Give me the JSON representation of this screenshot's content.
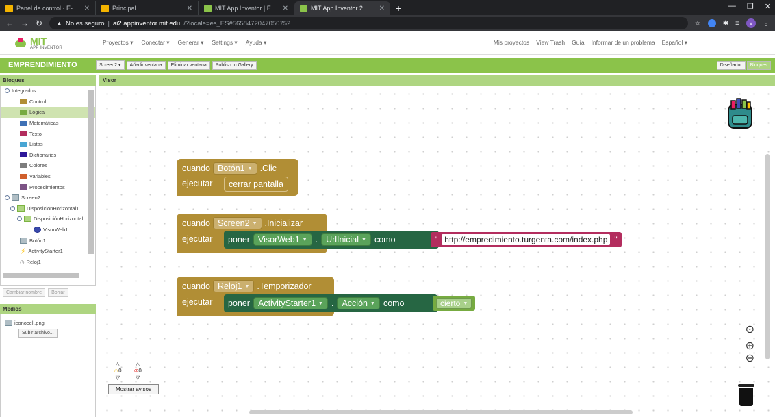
{
  "browser": {
    "tabs": [
      {
        "label": "Panel de control · E-mprendimie",
        "active": false
      },
      {
        "label": "Principal",
        "active": false
      },
      {
        "label": "MIT App Inventor | Explore MIT",
        "active": false
      },
      {
        "label": "MIT App Inventor 2",
        "active": true
      }
    ],
    "new_tab": "+",
    "security_label": "No es seguro",
    "url_host": "ai2.appinventor.mit.edu",
    "url_path": "/?locale=es_ES#5658472047050752"
  },
  "app": {
    "logo_text": "MIT",
    "logo_sub": "APP INVENTOR",
    "menu": [
      "Proyectos ▾",
      "Conectar ▾",
      "Generar ▾",
      "Settings ▾",
      "Ayuda ▾"
    ],
    "right_menu": [
      "Mis proyectos",
      "View Trash",
      "Guía",
      "Informar de un problema",
      "Español ▾"
    ],
    "project_title": "EMPRENDIMIENTO",
    "toolbar": [
      "Screen2 ▾",
      "Añadir ventana",
      "Eliminar ventana",
      "Publish to Gallery"
    ],
    "designer_label": "Diseñador",
    "blocks_label": "Bloques"
  },
  "blocks_panel": {
    "title": "Bloques",
    "root": "Integrados",
    "builtins": [
      {
        "label": "Control",
        "color": "#b18e35"
      },
      {
        "label": "Lógica",
        "color": "#77ab41"
      },
      {
        "label": "Matemáticas",
        "color": "#3f71b5"
      },
      {
        "label": "Texto",
        "color": "#b32d5e"
      },
      {
        "label": "Listas",
        "color": "#49a6d4"
      },
      {
        "label": "Dictionaries",
        "color": "#2d1799"
      },
      {
        "label": "Colores",
        "color": "#7d7d7d"
      },
      {
        "label": "Variables",
        "color": "#d05f2d"
      },
      {
        "label": "Procedimientos",
        "color": "#7c5385"
      }
    ],
    "components": {
      "screen": "Screen2",
      "h1": "DisposiciónHorizontal1",
      "h2": "DisposiciónHorizontal",
      "visor": "VisorWeb1",
      "boton": "Botón1",
      "activity": "ActivityStarter1",
      "reloj": "Reloj1"
    },
    "rename_btn": "Cambiar nombre",
    "delete_btn": "Borrar"
  },
  "media": {
    "title": "Medios",
    "file": "iconocell.png",
    "upload_btn": "Subir archivo..."
  },
  "workspace": {
    "title": "Visor",
    "block1": {
      "when": "cuando",
      "component": "Botón1",
      "event": ".Clic",
      "do": "ejecutar",
      "action": "cerrar pantalla"
    },
    "block2": {
      "when": "cuando",
      "component": "Screen2",
      "event": ".Inicializar",
      "do": "ejecutar",
      "set": "poner",
      "target": "VisorWeb1",
      "dot": ".",
      "prop": "UrlInicial",
      "to": "como",
      "q1": "\"",
      "value": "http://empredimiento.turgenta.com/index.php",
      "q2": "\""
    },
    "block3": {
      "when": "cuando",
      "component": "Reloj1",
      "event": ".Temporizador",
      "do": "ejecutar",
      "set": "poner",
      "target": "ActivityStarter1",
      "dot": ".",
      "prop": "Acción",
      "to": "como",
      "value": "cierto"
    },
    "warnings_count": "0",
    "errors_count": "0",
    "show_warnings": "Mostrar avisos"
  }
}
